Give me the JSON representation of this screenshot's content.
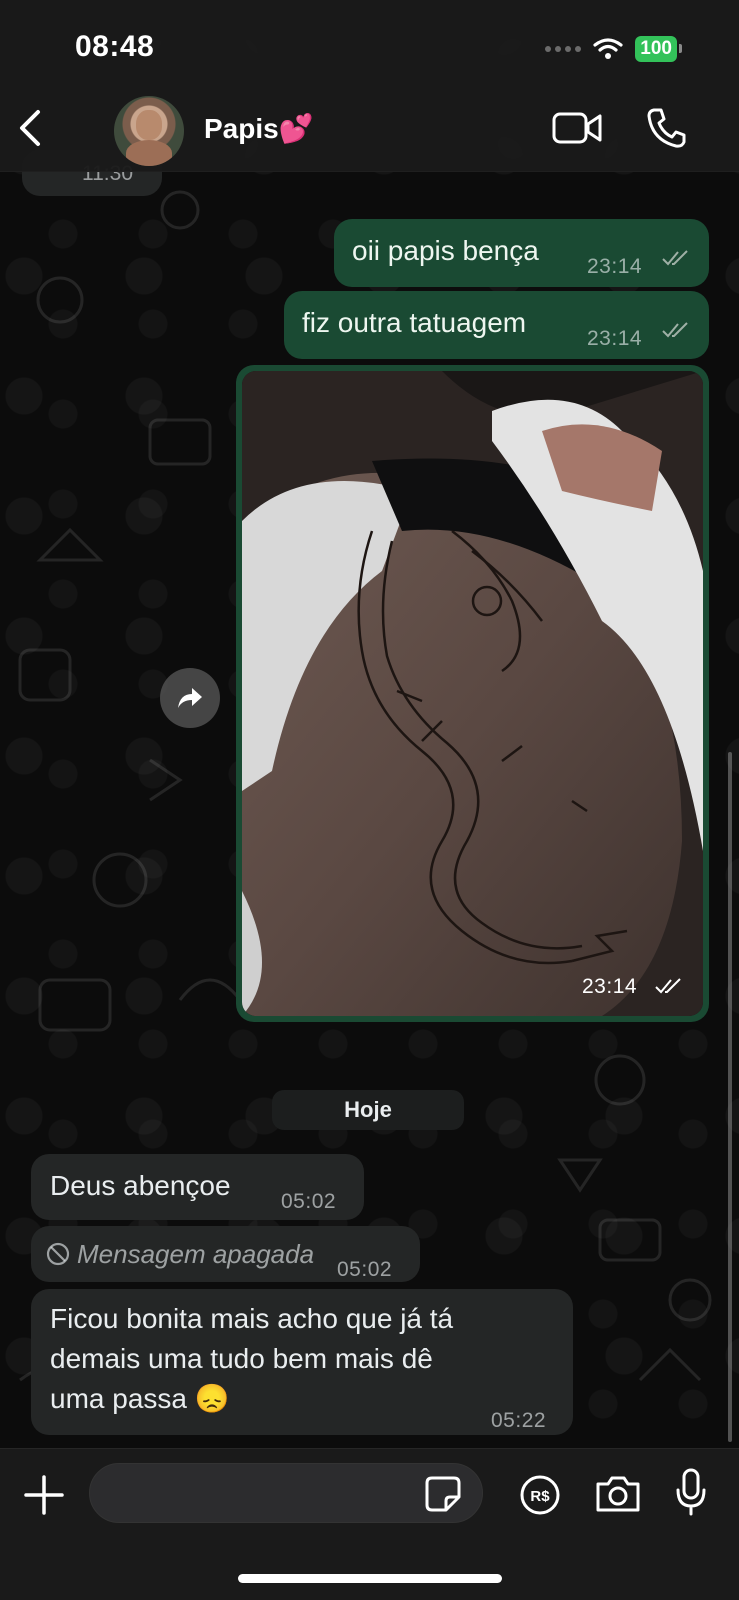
{
  "status_bar": {
    "time": "08:48",
    "battery": "100"
  },
  "header": {
    "contact_name": "Papis💕"
  },
  "previous": {
    "time": "11:30"
  },
  "messages_out": [
    {
      "text": "oii papis bença",
      "time": "23:14"
    },
    {
      "text": "fiz outra tatuagem",
      "time": "23:14"
    }
  ],
  "image_message": {
    "time": "23:14"
  },
  "day_separator": "Hoje",
  "messages_in": [
    {
      "text": "Deus abençoe",
      "time": "05:02"
    },
    {
      "text": "Mensagem apagada",
      "time": "05:02"
    },
    {
      "line1": "Ficou bonita mais acho que já tá",
      "line2": "demais uma tudo bem mais dê",
      "line3": "uma passa 😞",
      "time": "05:22"
    }
  ],
  "composer": {
    "value": "",
    "placeholder": ""
  },
  "colors": {
    "outgoing_bubble": "#1a4a33",
    "incoming_bubble": "#242626",
    "battery": "#33c25a"
  },
  "icons": [
    "back-chevron",
    "video-camera",
    "phone",
    "forward-arrow",
    "prohibited",
    "plus",
    "sticker",
    "pix-rs",
    "camera",
    "microphone"
  ]
}
